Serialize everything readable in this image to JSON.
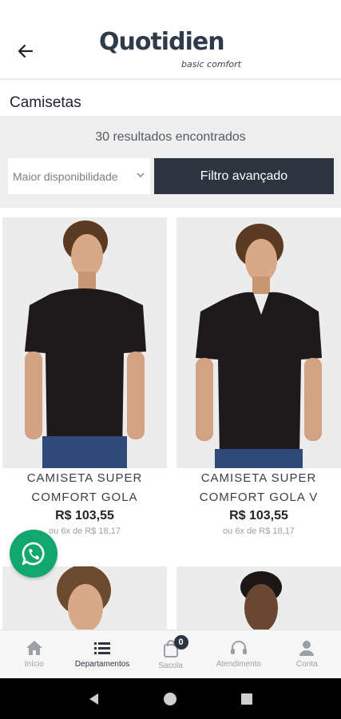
{
  "header": {
    "brand": "Quotidien",
    "tagline": "basic comfort"
  },
  "page": {
    "title": "Camisetas"
  },
  "filters": {
    "results_text": "30 resultados encontrados",
    "sort_value": "Maior disponibilidade",
    "advanced_filter_label": "Filtro avançado"
  },
  "products": [
    {
      "name_line1": "CAMISETA SUPER",
      "name_line2": "COMFORT GOLA",
      "price": "R$ 103,55",
      "installments": "ou 6x de R$ 18,17"
    },
    {
      "name_line1": "CAMISETA SUPER",
      "name_line2": "COMFORT GOLA V",
      "price": "R$ 103,55",
      "installments": "ou 6x de R$ 18,17"
    }
  ],
  "bottom_nav": {
    "items": [
      {
        "label": "Início",
        "icon": "home-icon"
      },
      {
        "label": "Departamentos",
        "icon": "list-icon"
      },
      {
        "label": "Sacola",
        "icon": "bag-icon",
        "badge": "0"
      },
      {
        "label": "Atendimento",
        "icon": "headset-icon"
      },
      {
        "label": "Conta",
        "icon": "user-icon"
      }
    ]
  },
  "colors": {
    "primary_dark": "#2c3440",
    "whatsapp_green": "#12a76c",
    "filter_bg": "#eeeeee"
  }
}
